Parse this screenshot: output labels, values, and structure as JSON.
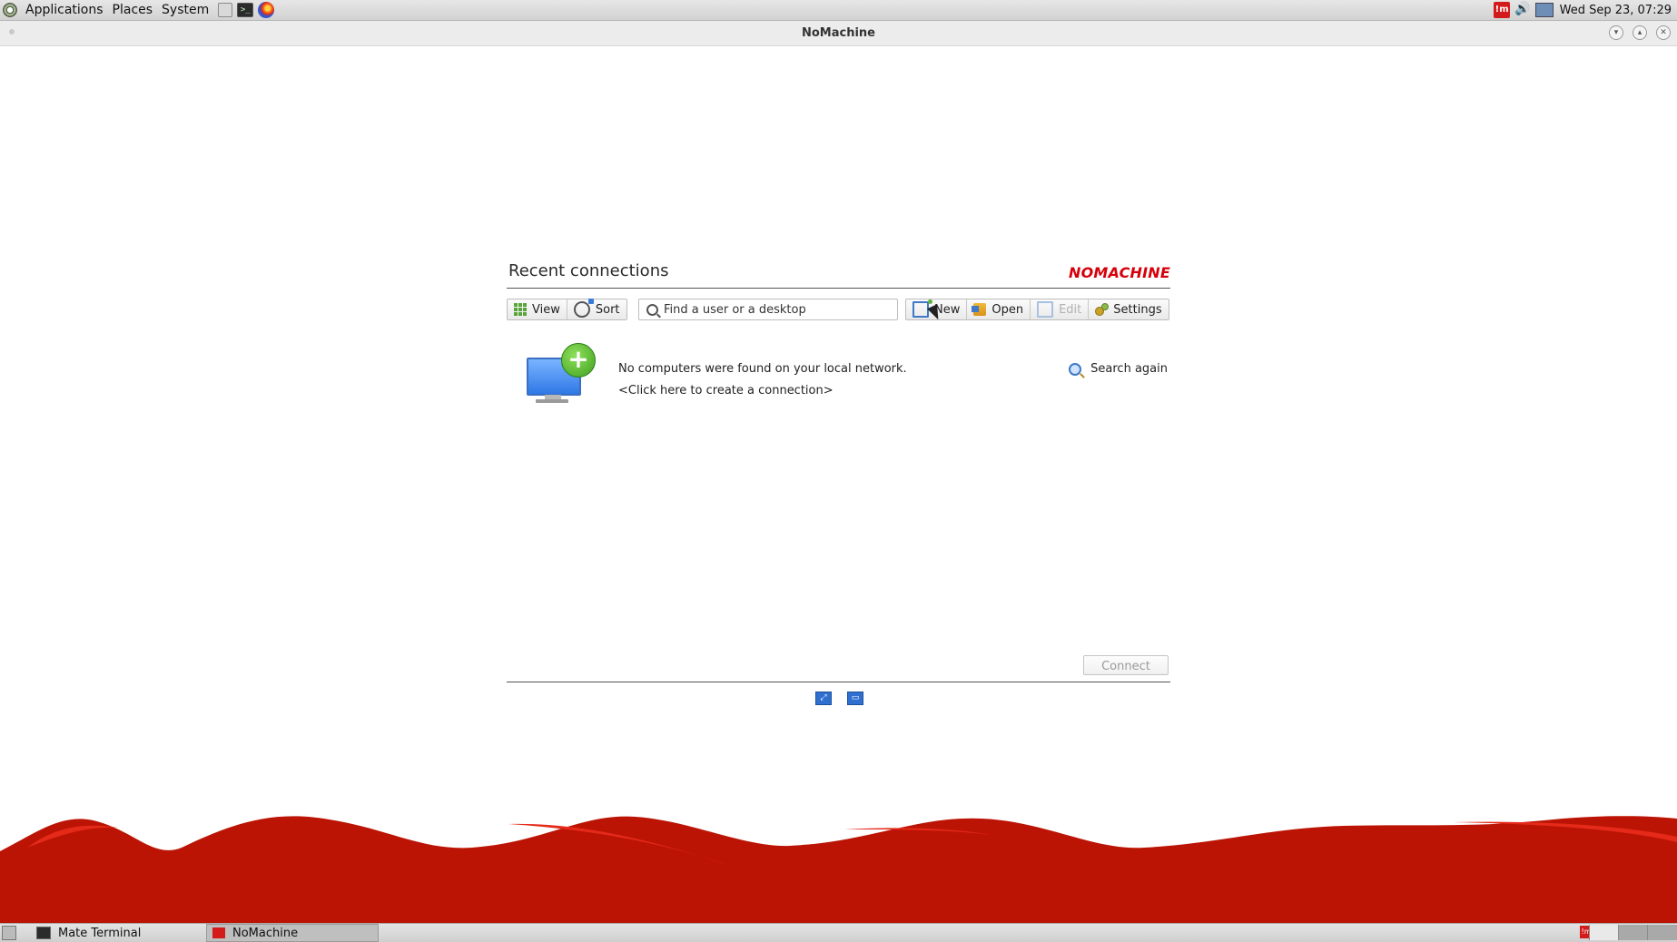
{
  "top_panel": {
    "menus": [
      "Applications",
      "Places",
      "System"
    ],
    "launchers": [
      "files-icon",
      "terminal-icon",
      "firefox-icon"
    ],
    "tray_nx_label": "!m",
    "clock": "Wed Sep 23, 07:29"
  },
  "window": {
    "title": "NoMachine"
  },
  "panel": {
    "title": "Recent connections",
    "logo": "NOMACHINE",
    "view_label": "View",
    "sort_label": "Sort",
    "search_placeholder": "Find a user or a desktop",
    "new_label": "New",
    "open_label": "Open",
    "edit_label": "Edit",
    "settings_label": "Settings",
    "no_computers_msg": "No computers were found on your local network.",
    "create_link": "<Click here to create a connection>",
    "search_again": "Search again",
    "connect_label": "Connect"
  },
  "taskbar": {
    "tasks": [
      {
        "label": "Mate Terminal",
        "active": false
      },
      {
        "label": "NoMachine",
        "active": true
      }
    ],
    "workspaces": 4
  },
  "colors": {
    "brand_red": "#c3170b",
    "accent_blue": "#2f78e6",
    "accent_green": "#3fa020"
  }
}
